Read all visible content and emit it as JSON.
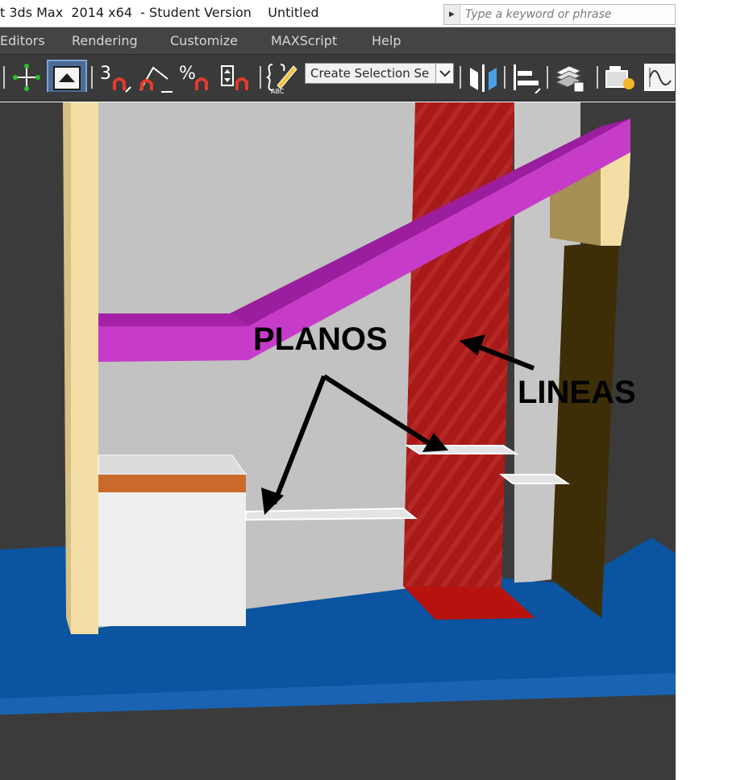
{
  "titlebar": {
    "title": "t 3ds Max  2014 x64  - Student Version    Untitled",
    "search_placeholder": "Type a keyword or phrase"
  },
  "menubar": {
    "items": [
      "Editors",
      "Rendering",
      "Customize",
      "MAXScript",
      "Help"
    ]
  },
  "toolbar": {
    "selection_set": "Create Selection Se",
    "icons": [
      "move-icon",
      "select-region-icon",
      "snap-3d-icon",
      "angle-snap-icon",
      "percent-snap-icon",
      "spinner-snap-icon",
      "edit-named-selection-icon",
      "mirror-icon",
      "align-icon",
      "layer-manager-icon",
      "render-setup-icon",
      "curve-editor-icon"
    ]
  },
  "viewport": {
    "annotations": {
      "planos": "PLANOS",
      "lineas": "LINEAS"
    },
    "colors": {
      "background": "#3b3b3b",
      "floor": "#0a54a0",
      "back_wall": "#c2c2c2",
      "left_column": "#f3dfa6",
      "beam": "#c63cc9",
      "red_column": "#a41816",
      "dark_column": "#3e2e07",
      "box_top_stripe": "#c96a2b",
      "box": "#eeeeee"
    }
  }
}
